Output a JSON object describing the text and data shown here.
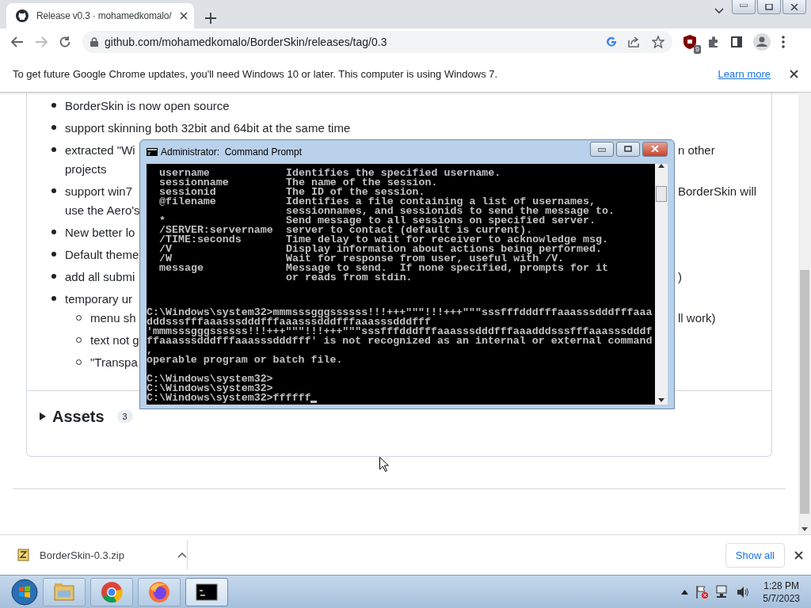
{
  "browser": {
    "tabs": [
      {
        "title": "Release v0.3 · mohamedkomalo/",
        "selected": true
      }
    ],
    "address": "github.com/mohamedkomalo/BorderSkin/releases/tag/0.3",
    "extension_badge": "9"
  },
  "info_bar": {
    "message": "To get future Google Chrome updates, you'll need Windows 10 or later. This computer is using Windows 7.",
    "link": "Learn more"
  },
  "release": {
    "items": [
      {
        "lines": [
          {
            "left": "BorderSkin is now open source"
          }
        ]
      },
      {
        "lines": [
          {
            "left": "support skinning both 32bit and 64bit at the same time"
          }
        ]
      },
      {
        "lines": [
          {
            "left": "extracted \"Wi",
            "right": "n other"
          },
          {
            "left": "projects"
          }
        ]
      },
      {
        "lines": [
          {
            "left": "support win7",
            "right": "BorderSkin will"
          },
          {
            "left": "use the Aero's"
          }
        ]
      },
      {
        "lines": [
          {
            "left": "New better lo"
          }
        ]
      },
      {
        "lines": [
          {
            "left": "Default theme"
          }
        ]
      },
      {
        "lines": [
          {
            "left": "add all submi",
            "right": ")"
          }
        ]
      },
      {
        "lines": [
          {
            "left": "temporary ur"
          }
        ],
        "children": [
          {
            "lines": [
              {
                "left": "menu sh",
                "right": "ll work)"
              }
            ]
          },
          {
            "lines": [
              {
                "left": "text not g"
              }
            ]
          },
          {
            "lines": [
              {
                "left": "\"Transpa"
              }
            ]
          }
        ]
      }
    ],
    "assets": {
      "label": "Assets",
      "count": "3"
    }
  },
  "console_window": {
    "title": "Administrator:  Command Prompt",
    "blocks": [
      {
        "kind": "help",
        "rows": [
          {
            "param": "username",
            "desc": "Identifies the specified username."
          },
          {
            "param": "sessionname",
            "desc": "The name of the session."
          },
          {
            "param": "sessionid",
            "desc": "The ID of the session."
          },
          {
            "param": "@filename",
            "desc": "Identifies a file containing a list of usernames,"
          },
          {
            "desc": "sessionnames, and sessionids to send the message to."
          },
          {
            "param": "*",
            "desc": "Send message to all sessions on specified server."
          },
          {
            "param": "/SERVER:servername",
            "desc": "server to contact (default is current)."
          },
          {
            "param": "/TIME:seconds",
            "desc": "Time delay to wait for receiver to acknowledge msg."
          },
          {
            "param": "/V",
            "desc": "Display information about actions being performed."
          },
          {
            "param": "/W",
            "desc": "Wait for response from user, useful with /V."
          },
          {
            "param": "message",
            "desc": "Message to send.  If none specified, prompts for it"
          },
          {
            "desc": "or reads from stdin."
          }
        ]
      },
      {
        "kind": "output",
        "lines": [
          "C:\\Windows\\system32>mmmsssgggssssss!!!+++\"\"\"!!!+++\"\"\"sssfffdddfffaaasssdddfffaaa",
          "dddsssfffaaasssdddfffaaasssdddfffaaasssdddfff",
          "'mmmsssgggssssss!!!+++\"\"\"!!!+++\"\"\"sssfffdddfffaaasssdddfffaaadddsssfffaaasssdddf",
          "ffaaasssdddfffaaasssdddfff' is not recognized as an internal or external command",
          ",",
          "operable program or batch file."
        ]
      },
      {
        "kind": "prompt",
        "lines": [
          "C:\\Windows\\system32>",
          "C:\\Windows\\system32>",
          "C:\\Windows\\system32>ffffff"
        ]
      }
    ]
  },
  "downloads": {
    "file": "BorderSkin-0.3.zip",
    "show_all": "Show all"
  },
  "taskbar": {
    "apps": [
      {
        "kind": "folder",
        "selected": false
      },
      {
        "kind": "chrome",
        "selected": false
      },
      {
        "kind": "firefox",
        "selected": false
      },
      {
        "kind": "terminal",
        "selected": true
      }
    ],
    "time": "1:28 PM",
    "date": "5/7/2023"
  }
}
